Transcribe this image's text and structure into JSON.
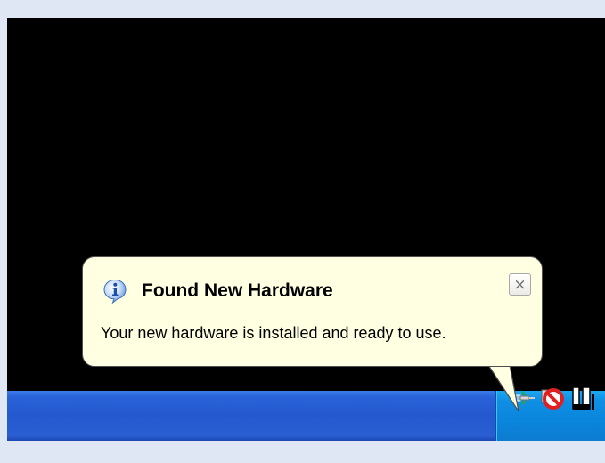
{
  "notification": {
    "title": "Found New Hardware",
    "message": "Your new hardware is installed and ready to use.",
    "close_glyph": "×",
    "icon": "info-icon"
  },
  "tray_icons": [
    "safely-remove-hardware-icon",
    "network-disabled-icon",
    "connection-icon"
  ],
  "colors": {
    "desktop": "#000000",
    "taskbar": "#2458cf",
    "tray": "#0a86dc",
    "balloon": "#ffffe1"
  }
}
